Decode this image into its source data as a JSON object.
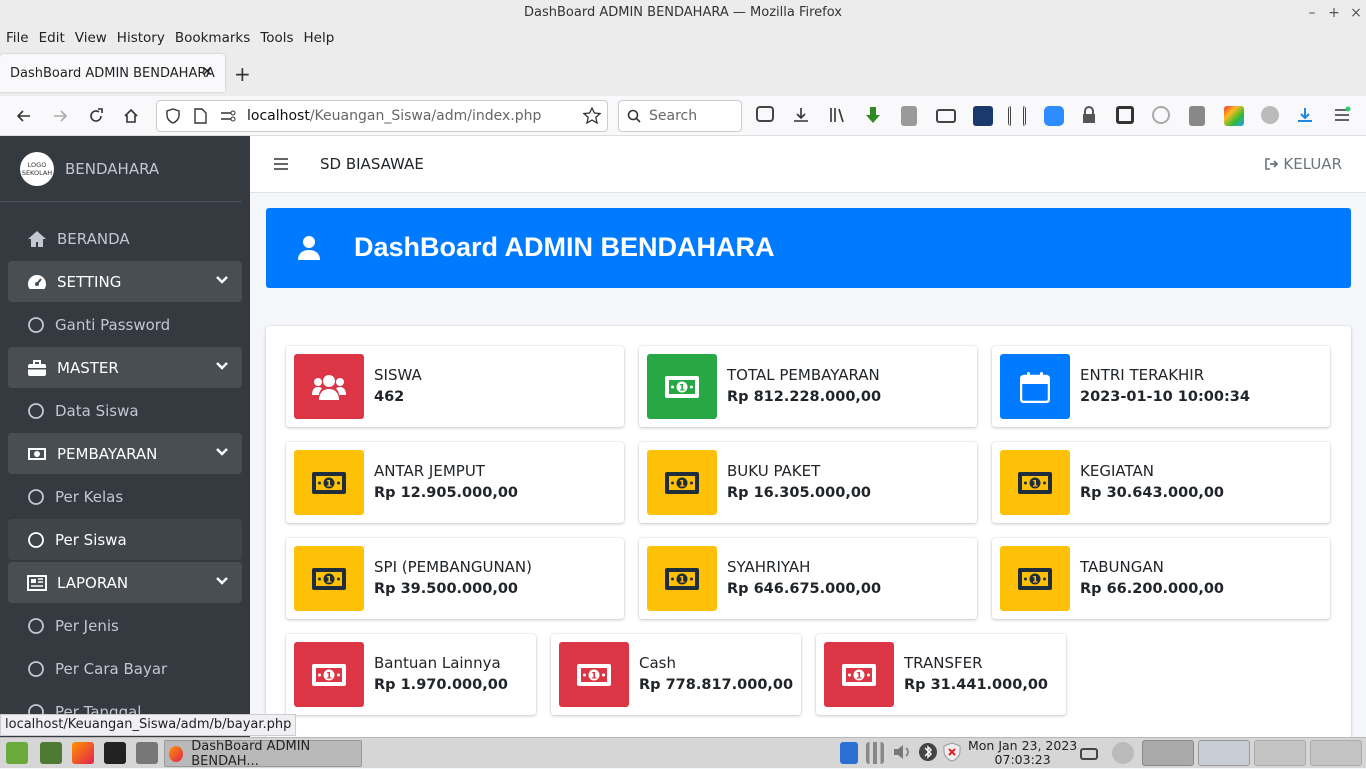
{
  "window": {
    "title": "DashBoard ADMIN BENDAHARA — Mozilla Firefox"
  },
  "menubar": [
    "File",
    "Edit",
    "View",
    "History",
    "Bookmarks",
    "Tools",
    "Help"
  ],
  "tab": {
    "title": "DashBoard ADMIN BENDAHARA"
  },
  "url": {
    "host": "localhost",
    "path": "/Keuangan_Siswa/adm/index.php"
  },
  "search": {
    "placeholder": "Search"
  },
  "sidebar": {
    "logo_text": "LOGO SEKOLAH",
    "brand": "BENDAHARA",
    "items": [
      {
        "label": "BERANDA",
        "icon": "home-icon",
        "type": "link"
      },
      {
        "label": "SETTING",
        "icon": "dashboard-gauge-icon",
        "type": "group"
      },
      {
        "label": "Ganti Password",
        "icon": "circle-icon",
        "type": "sub"
      },
      {
        "label": "MASTER",
        "icon": "briefcase-icon",
        "type": "group"
      },
      {
        "label": "Data Siswa",
        "icon": "circle-icon",
        "type": "sub"
      },
      {
        "label": "PEMBAYARAN",
        "icon": "money-icon",
        "type": "group"
      },
      {
        "label": "Per Kelas",
        "icon": "circle-icon",
        "type": "sub"
      },
      {
        "label": "Per Siswa",
        "icon": "circle-icon",
        "type": "sub"
      },
      {
        "label": "LAPORAN",
        "icon": "newspaper-icon",
        "type": "group"
      },
      {
        "label": "Per Jenis",
        "icon": "circle-icon",
        "type": "sub"
      },
      {
        "label": "Per Cara Bayar",
        "icon": "circle-icon",
        "type": "sub"
      },
      {
        "label": "Per Tanggal",
        "icon": "circle-icon",
        "type": "sub"
      }
    ]
  },
  "header": {
    "school": "SD BIASAWAE",
    "logout": "KELUAR"
  },
  "banner": {
    "title": "DashBoard ADMIN BENDAHARA"
  },
  "stats": [
    {
      "label": "SISWA",
      "value": "462",
      "color": "#dc3545",
      "icon": "users-icon"
    },
    {
      "label": "TOTAL PEMBAYARAN",
      "value": "Rp 812.228.000,00",
      "color": "#28a745",
      "icon": "money-icon"
    },
    {
      "label": "ENTRI TERAKHIR",
      "value": "2023-01-10 10:00:34",
      "color": "#007bff",
      "icon": "calendar-icon"
    },
    {
      "label": "ANTAR JEMPUT",
      "value": "Rp 12.905.000,00",
      "color": "#ffc107",
      "icon": "money-icon"
    },
    {
      "label": "BUKU PAKET",
      "value": "Rp 16.305.000,00",
      "color": "#ffc107",
      "icon": "money-icon"
    },
    {
      "label": "KEGIATAN",
      "value": "Rp 30.643.000,00",
      "color": "#ffc107",
      "icon": "money-icon"
    },
    {
      "label": "SPI (PEMBANGUNAN)",
      "value": "Rp 39.500.000,00",
      "color": "#ffc107",
      "icon": "money-icon"
    },
    {
      "label": "SYAHRIYAH",
      "value": "Rp 646.675.000,00",
      "color": "#ffc107",
      "icon": "money-icon"
    },
    {
      "label": "TABUNGAN",
      "value": "Rp 66.200.000,00",
      "color": "#ffc107",
      "icon": "money-icon"
    },
    {
      "label": "Bantuan Lainnya",
      "value": "Rp 1.970.000,00",
      "color": "#dc3545",
      "icon": "money-icon"
    },
    {
      "label": "Cash",
      "value": "Rp 778.817.000,00",
      "color": "#dc3545",
      "icon": "money-icon"
    },
    {
      "label": "TRANSFER",
      "value": "Rp 31.441.000,00",
      "color": "#dc3545",
      "icon": "money-icon"
    }
  ],
  "statusbar": {
    "link": "localhost/Keuangan_Siswa/adm/b/bayar.php"
  },
  "taskbar": {
    "window": "DashBoard ADMIN BENDAH...",
    "date": "Mon Jan 23, 2023",
    "time": "07:03:23"
  }
}
